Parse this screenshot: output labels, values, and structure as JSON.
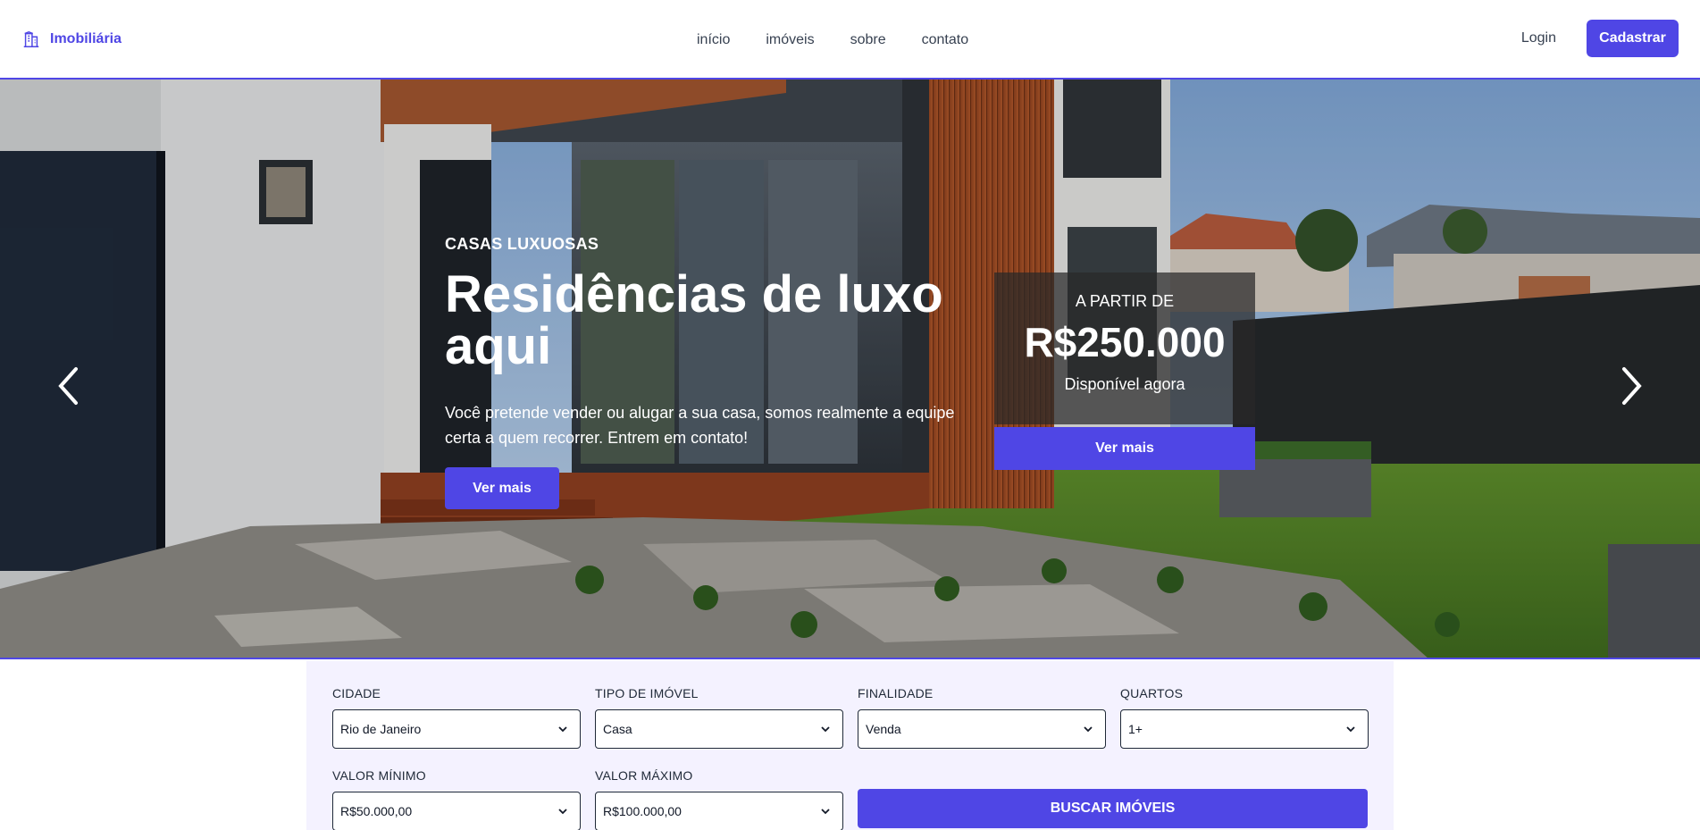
{
  "header": {
    "brand": "Imobiliária",
    "nav": [
      "início",
      "imóveis",
      "sobre",
      "contato"
    ],
    "login_label": "Login",
    "signup_label": "Cadastrar"
  },
  "hero": {
    "eyebrow": "CASAS LUXUOSAS",
    "title": "Residências de luxo aqui",
    "text": "Você pretende vender ou alugar a sua casa, somos realmente a equipe certa a quem recorrer. Entrem em contato!",
    "button_label": "Ver mais",
    "price": {
      "label": "A PARTIR DE",
      "value": "R$250.000",
      "availability": "Disponível agora",
      "button_label": "Ver mais"
    }
  },
  "search": {
    "cidade": {
      "label": "CIDADE",
      "value": "Rio de Janeiro"
    },
    "tipo": {
      "label": "TIPO DE IMÓVEL",
      "value": "Casa"
    },
    "finalidade": {
      "label": "FINALIDADE",
      "value": "Venda"
    },
    "quartos": {
      "label": "QUARTOS",
      "value": "1+"
    },
    "valor_min": {
      "label": "VALOR MÍNIMO",
      "value": "R$50.000,00"
    },
    "valor_max": {
      "label": "VALOR MÁXIMO",
      "value": "R$100.000,00"
    },
    "button_label": "BUSCAR IMÓVEIS"
  },
  "colors": {
    "accent": "#4f46e5",
    "panel": "#f4f2ff"
  }
}
